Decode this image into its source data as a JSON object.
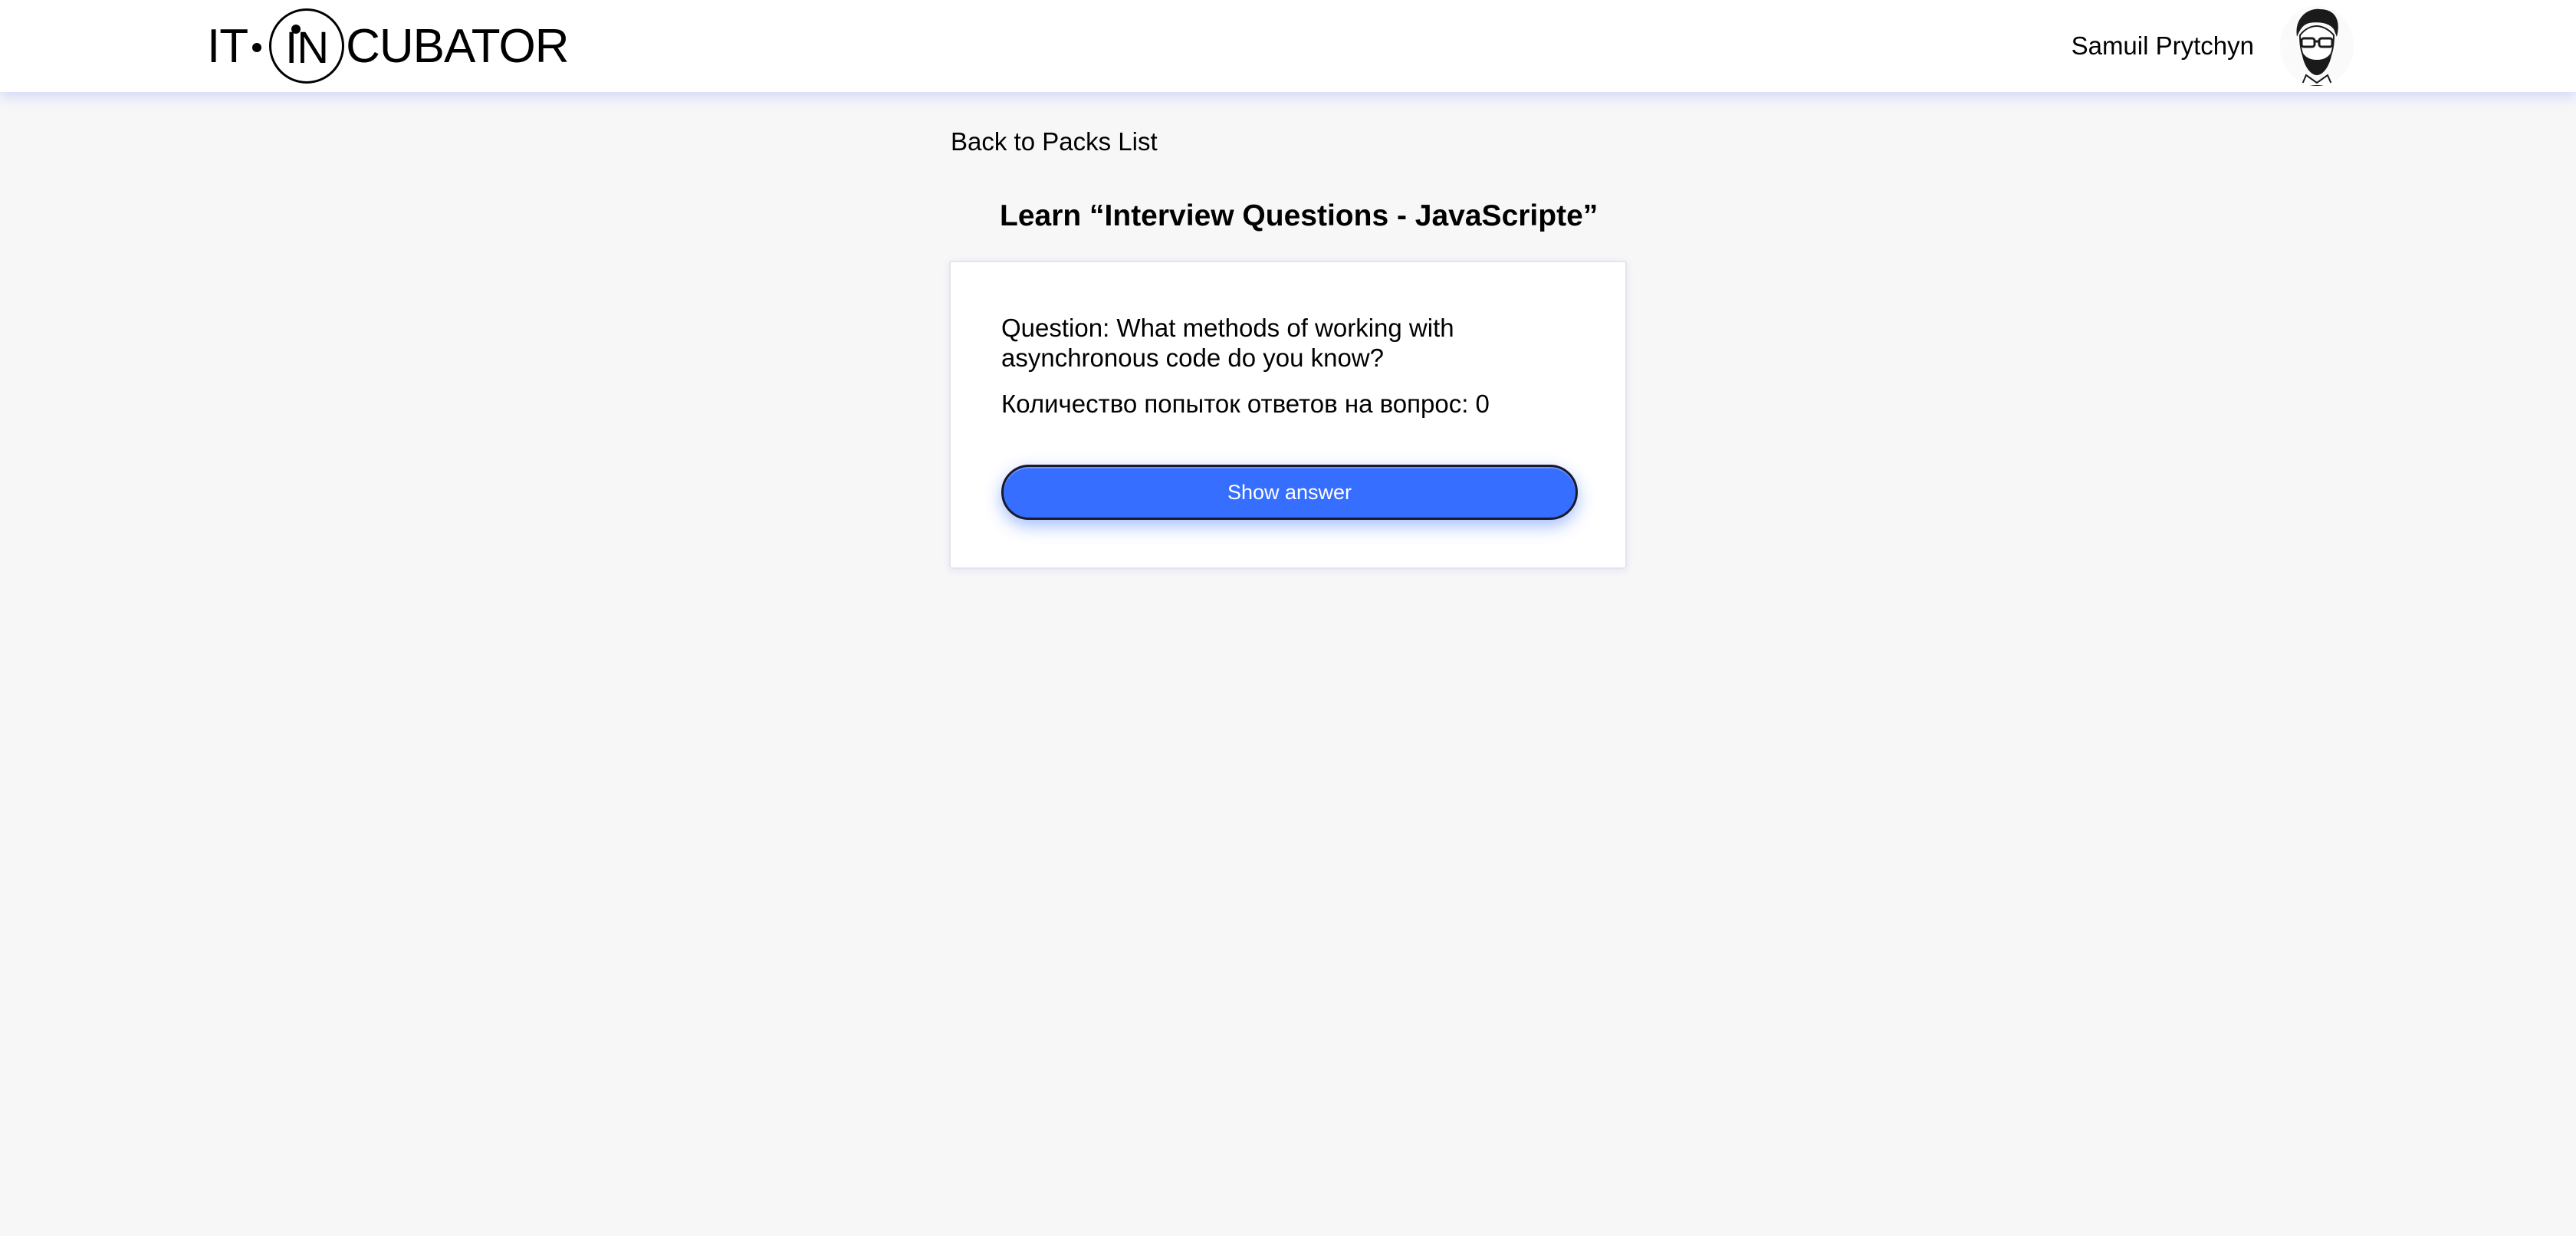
{
  "header": {
    "logo": {
      "it": "IT",
      "in": "IN",
      "cubator": "CUBATOR"
    },
    "user_name": "Samuil Prytchyn"
  },
  "nav": {
    "back_label": "Back to Packs List"
  },
  "page": {
    "title": "Learn “Interview Questions - JavaScripte”"
  },
  "card": {
    "question": "Question: What methods of working with asynchronous code do you know?",
    "attempts": "Количество попыток ответов на вопрос: 0",
    "show_answer_label": "Show answer"
  },
  "colors": {
    "background": "#f7f7f8",
    "accent": "#366eff",
    "header_shadow": "#7484ff"
  },
  "icons": {
    "logo": "it-incubator-logo",
    "avatar": "user-avatar-icon"
  }
}
